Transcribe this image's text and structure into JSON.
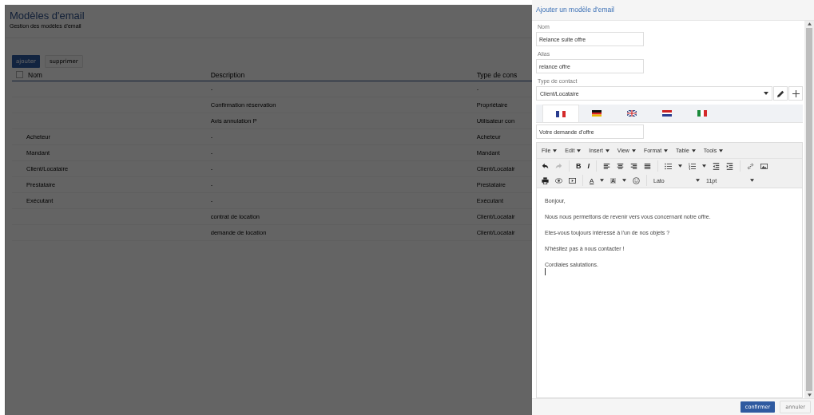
{
  "page": {
    "title": "Modèles d'email",
    "subtitle": "Gestion des modèles d'email"
  },
  "actions": [
    {
      "label": "ajouter",
      "kind": "primary"
    },
    {
      "label": "supprimer",
      "kind": "secondary"
    }
  ],
  "table": {
    "select_all": {
      "checked": false
    },
    "columns": [
      "Nom",
      "Description",
      "Type de cons"
    ],
    "rows": [
      {
        "description": "-",
        "type": "-"
      },
      {
        "description": "Confirmation réservation",
        "type": "Propriétaire"
      },
      {
        "description": "Avis annulation P",
        "type": "Utilisateur con"
      },
      {
        "name": "Acheteur",
        "description": "-",
        "type": "Acheteur"
      },
      {
        "name": "Mandant",
        "description": "-",
        "type": "Mandant"
      },
      {
        "name": "Client/Locataire",
        "description": "-",
        "type": "Client/Locatair"
      },
      {
        "name": "Prestataire",
        "description": "-",
        "type": "Prestataire"
      },
      {
        "name": "Exécutant",
        "description": "-",
        "type": "Exécutant"
      },
      {
        "description": "contrat de location",
        "type": "Client/Locatair"
      },
      {
        "description": "demande de location",
        "type": "Client/Locatair"
      }
    ]
  },
  "panel": {
    "title": "Ajouter un modèle d'email",
    "fields": [
      {
        "label": "Nom",
        "value": "Relance suite offre"
      },
      {
        "label": "Alias",
        "value": "relance offre"
      }
    ],
    "contact_type": {
      "label": "Type de contact",
      "value": "Client/Locataire"
    },
    "language_tabs": [
      {
        "kind": "fr",
        "selected": true
      },
      {
        "kind": "de",
        "selected": false
      },
      {
        "kind": "gb",
        "selected": false
      },
      {
        "kind": "nl",
        "selected": false
      },
      {
        "kind": "it",
        "selected": false
      }
    ],
    "subject": "Votre demande d'offre",
    "editor": {
      "menu": [
        "File",
        "Edit",
        "Insert",
        "View",
        "Format",
        "Table",
        "Tools"
      ],
      "bold": "B",
      "italic": "I",
      "text_color": "A",
      "background_color": "A",
      "font": "Lato",
      "size": "11pt",
      "paragraphs": [
        "Bonjour,",
        "Nous nous permettons de revenir vers vous concernant notre offre.",
        "Etes-vous toujours intéressé à l'un de nos objets ?",
        "N'hésitez pas à nous contacter !",
        "Cordiales salutations."
      ]
    },
    "buttons": [
      {
        "label": "confirmer",
        "kind": "primary"
      },
      {
        "label": "annuler",
        "kind": "secondary"
      }
    ]
  }
}
